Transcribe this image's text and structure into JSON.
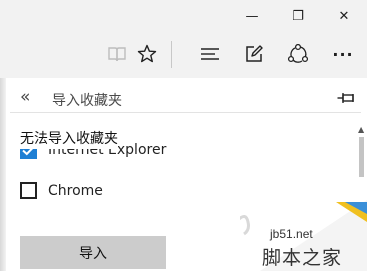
{
  "window": {
    "controls": {
      "minimize": "—",
      "maximize": "❐",
      "close": "✕"
    }
  },
  "toolbar": {
    "icons": [
      "reading-view-icon",
      "favorites-star-icon",
      "hub-icon",
      "web-note-icon",
      "share-icon",
      "more-icon"
    ],
    "more_label": "···"
  },
  "panel": {
    "back_label": "«",
    "title": "导入收藏夹",
    "notice": "无法导入收藏夹",
    "options": [
      {
        "label": "Internet Explorer",
        "checked": true
      },
      {
        "label": "Chrome",
        "checked": false
      }
    ],
    "import_button": "导入"
  },
  "watermark": {
    "url": "jb51.net",
    "text": "脚本之家"
  }
}
